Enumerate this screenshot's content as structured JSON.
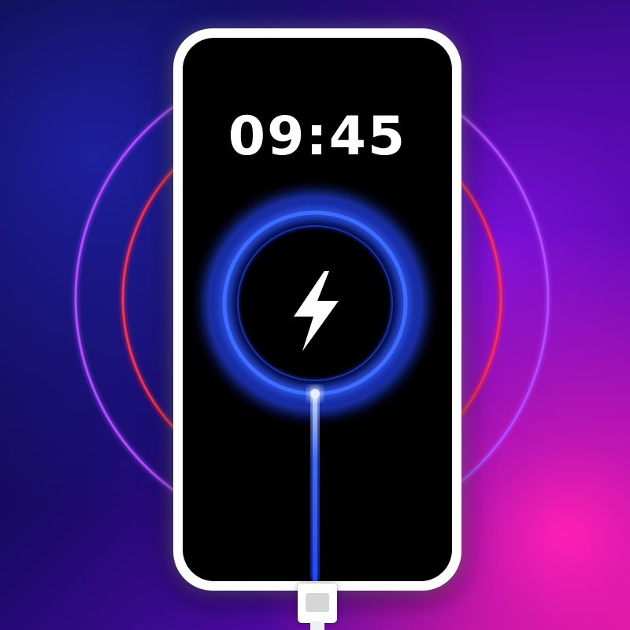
{
  "lock_screen": {
    "clock": "09:45",
    "status_icon": "lightning-bolt-icon",
    "charging": true
  },
  "colors": {
    "outer_ring": "#a23bff",
    "inner_ring": "#ff2d4a",
    "charge_ring": "#2e6bff",
    "phone_frame": "#ffffff",
    "screen": "#000000"
  }
}
